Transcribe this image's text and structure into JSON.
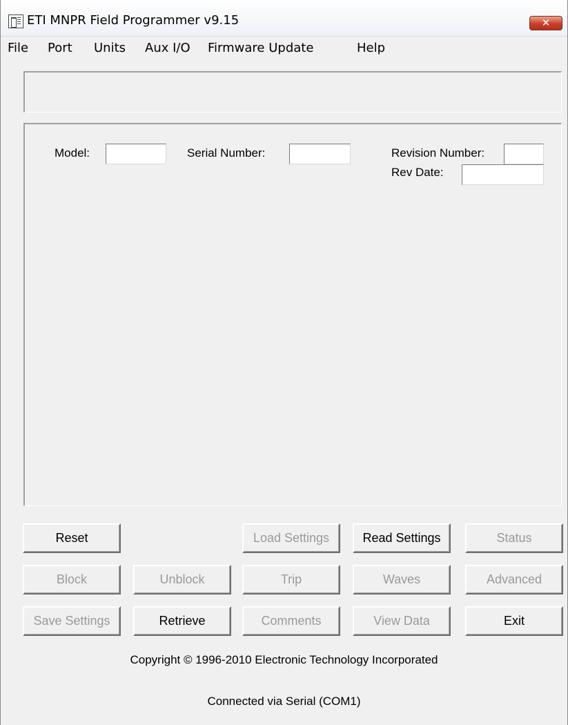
{
  "window": {
    "title": "ETI MNPR Field Programmer v9.15",
    "close_glyph": "✕",
    "accent_close": "#c9402a"
  },
  "menu": [
    "File",
    "Port",
    "Units",
    "Aux I/O",
    "Firmware Update",
    "Help"
  ],
  "status_message": "",
  "device_info": {
    "model_label": "Model:",
    "model_value": "",
    "serial_label": "Serial Number:",
    "serial_value": "",
    "revision_label": "Revision Number:",
    "revision_value": "",
    "rev_date_label": "Rev Date:",
    "rev_date_value": ""
  },
  "buttons": {
    "reset": "Reset",
    "load_settings": "Load Settings",
    "read_settings": "Read Settings",
    "status": "Status",
    "block": "Block",
    "unblock": "Unblock",
    "trip": "Trip",
    "waves": "Waves",
    "advanced": "Advanced",
    "save_settings": "Save Settings",
    "retrieve": "Retrieve",
    "comments": "Comments",
    "view_data": "View Data",
    "exit": "Exit"
  },
  "footer": {
    "copyright": "Copyright © 1996-2010 Electronic Technology Incorporated",
    "connection": "Connected via Serial (COM1)"
  }
}
